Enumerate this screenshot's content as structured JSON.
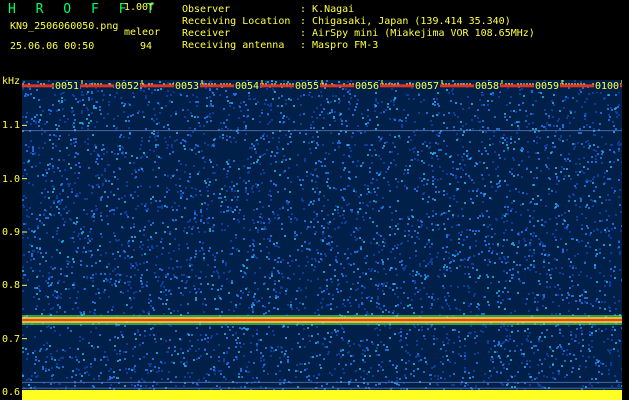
{
  "header": {
    "app_title": "H R O F F T",
    "version": "1.00f",
    "file_name": "KN9_2506060050.png",
    "mode": "meleor",
    "date_time": "25.06.06 00:50",
    "count": "94"
  },
  "info": [
    {
      "label": "Observer",
      "value": ": K.Nagai"
    },
    {
      "label": "Receiving Location",
      "value": ": Chigasaki, Japan (139.414 35.340)"
    },
    {
      "label": "Receiver",
      "value": ": AirSpy mini (Miakejima VOR 108.65MHz)"
    },
    {
      "label": "Receiving antenna",
      "value": ": Maspro FM-3"
    }
  ],
  "axis": {
    "unit": "kHz",
    "y_ticks": [
      "1.1",
      "1.0",
      "0.9",
      "0.8",
      "0.7",
      "0.6"
    ],
    "y_tick_values": [
      1.1,
      1.0,
      0.9,
      0.8,
      0.7,
      0.6
    ],
    "x_ticks": [
      "0051",
      "0052",
      "0053",
      "0054",
      "0055",
      "0056",
      "0057",
      "0058",
      "0059",
      "0100"
    ]
  },
  "spectrogram": {
    "y_range_khz": [
      0.585,
      1.185
    ],
    "strong_trace_khz": 0.735,
    "top_trace_khz": 1.175,
    "colors": {
      "background": "#00204a",
      "noise_dark": "#0b3c9b",
      "noise_mid": "#1d6ad6",
      "noise_light": "#22b8e8",
      "trace_hot": "#ff3a1e",
      "trace_warm": "#ffd028",
      "trace_green": "#5bff62",
      "bottom_band": "#ffff22"
    }
  }
}
